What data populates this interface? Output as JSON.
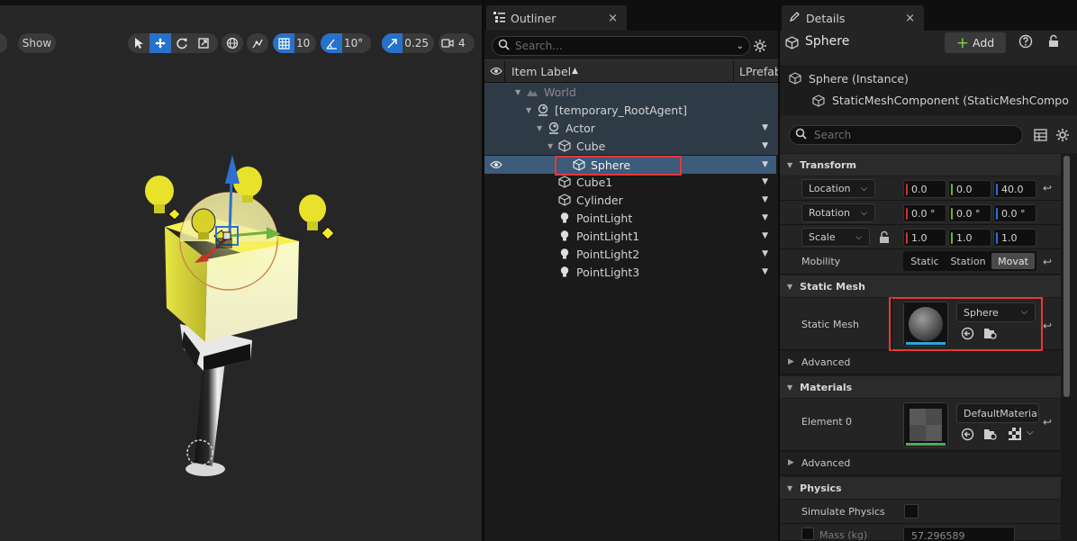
{
  "viewport": {
    "show_label": "Show",
    "grid_value": "10",
    "angle_value": "10°",
    "scale_value": "0.25",
    "camera_value": "4"
  },
  "outliner": {
    "tab_title": "Outliner",
    "close": "×",
    "search_placeholder": "Search...",
    "col_item_label": "Item Label",
    "col_prefab": "LPrefab",
    "rows": [
      {
        "label": "World"
      },
      {
        "label": "[temporary_RootAgent]"
      },
      {
        "label": "Actor"
      },
      {
        "label": "Cube"
      },
      {
        "label": "Sphere"
      },
      {
        "label": "Cube1"
      },
      {
        "label": "Cylinder"
      },
      {
        "label": "PointLight"
      },
      {
        "label": "PointLight1"
      },
      {
        "label": "PointLight2"
      },
      {
        "label": "PointLight3"
      }
    ]
  },
  "details": {
    "tab_title": "Details",
    "close": "×",
    "object_name": "Sphere",
    "add_label": "Add",
    "instance_label": "Sphere (Instance)",
    "component_label": "StaticMeshComponent (StaticMeshComponent)",
    "search_placeholder": "Search",
    "sections": {
      "transform": "Transform",
      "static_mesh": "Static Mesh",
      "materials": "Materials",
      "physics": "Physics",
      "advanced": "Advanced"
    },
    "location_label": "Location",
    "location": [
      "0.0",
      "0.0",
      "40.0"
    ],
    "rotation_label": "Rotation",
    "rotation": [
      "0.0 °",
      "0.0 °",
      "0.0 °"
    ],
    "scale_label": "Scale",
    "scale": [
      "1.0",
      "1.0",
      "1.0"
    ],
    "mobility_label": "Mobility",
    "mobility_options": [
      "Static",
      "Station",
      "Movat"
    ],
    "static_mesh_label": "Static Mesh",
    "static_mesh_value": "Sphere",
    "element0_label": "Element 0",
    "element0_value": "DefaultMaterial",
    "simulate_physics_label": "Simulate Physics",
    "mass_label": "Mass (kg)",
    "mass_value": "57.296589"
  },
  "colors": {
    "accent": "#2671c9",
    "selection": "#3d5b7a",
    "highlight_box": "#e5383b",
    "axis_x": "#c8332b",
    "axis_y": "#6cb33f",
    "axis_z": "#2f6fd4"
  }
}
